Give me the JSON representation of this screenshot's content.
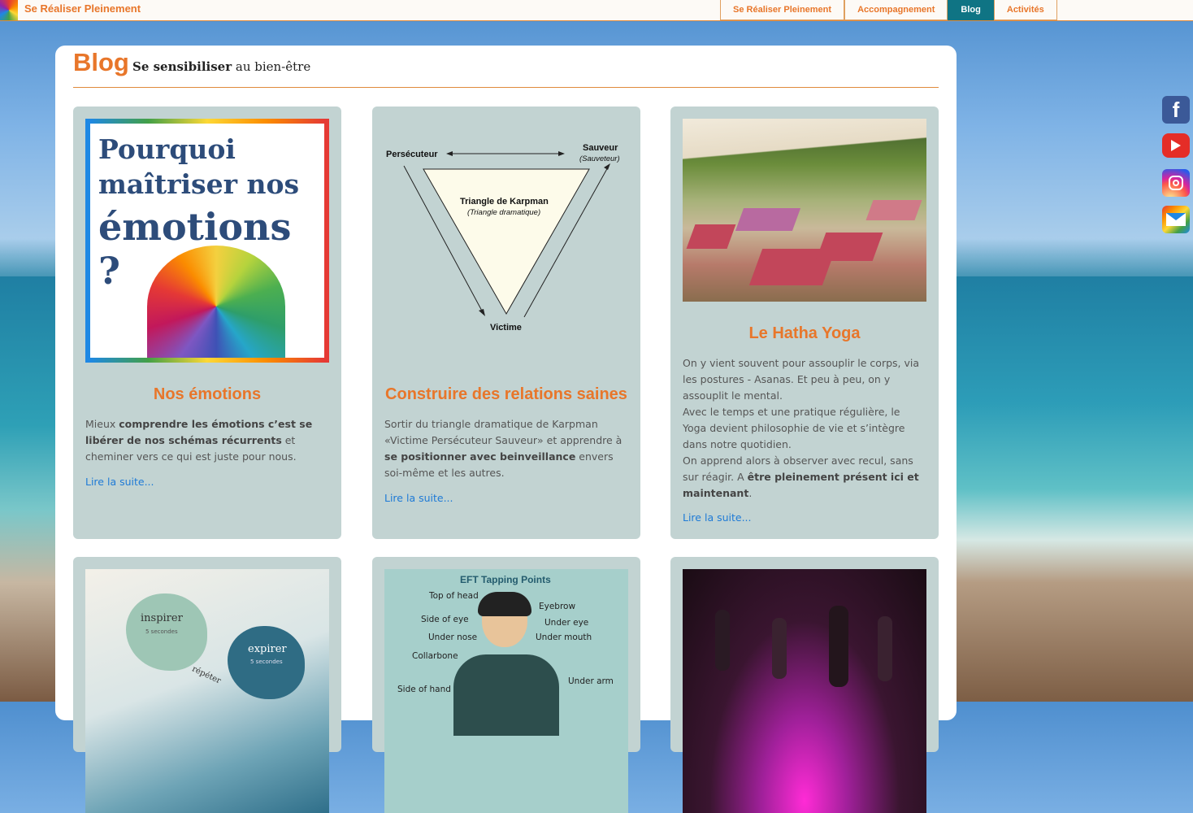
{
  "site": {
    "title": "Se Réaliser Pleinement"
  },
  "nav": {
    "items": [
      {
        "label": "Se Réaliser Pleinement"
      },
      {
        "label": "Accompagnement"
      },
      {
        "label": "Blog"
      },
      {
        "label": "Activités"
      }
    ],
    "active": "Blog"
  },
  "social": [
    "facebook-icon",
    "youtube-icon",
    "instagram-icon",
    "mail-icon"
  ],
  "header": {
    "title": "Blog",
    "subtitle_bold": "Se sensibiliser",
    "subtitle_rest": " au bien-être"
  },
  "cards": [
    {
      "image_text": {
        "line1": "Pourquoi",
        "line2": "maîtriser nos",
        "line3": "émotions ?"
      },
      "title": "Nos émotions",
      "text_1": "Mieux ",
      "bold_1": "comprendre les émotions c’est se libérer de nos schémas récurrents",
      "text_2": " et cheminer vers ce qui est juste pour nous.",
      "more": "Lire la suite..."
    },
    {
      "diagram": {
        "persecuteur": "Persécuteur",
        "sauveur": "Sauveur",
        "sauveur_sub": "(Sauveteur)",
        "center_title": "Triangle de Karpman",
        "center_sub": "(Triangle dramatique)",
        "victime": "Victime"
      },
      "title": "Construire des relations saines",
      "text_1": "Sortir du triangle dramatique de Karpman «Victime Persécuteur Sauveur» et apprendre à ",
      "bold_1": "se positionner avec beinveillance",
      "text_2": " envers soi-même et les autres.",
      "more": "Lire la suite..."
    },
    {
      "title": "Le Hatha Yoga",
      "p1": "On y vient souvent pour assouplir le corps, via les postures - Asanas. Et peu à peu, on y assouplit le mental.",
      "p2": "Avec le temps et une pratique régulière, le Yoga devient philosophie de vie et s’intègre dans notre quotidien.",
      "p3_text": "On apprend alors à observer avec recul, sans sur réagir. A ",
      "p3_bold": "être pleinement présent ici et maintenant",
      "p3_end": ".",
      "more": "Lire la suite..."
    },
    {
      "image_text": {
        "inspirer": "inspirer",
        "inspirer_sub": "5 secondes",
        "expirer": "expirer",
        "expirer_sub": "5 secondes",
        "repeter": "répéter"
      }
    },
    {
      "image_text": {
        "title": "EFT Tapping Points",
        "labels": [
          "Top of head",
          "Eyebrow",
          "Side of eye",
          "Under eye",
          "Under nose",
          "Under mouth",
          "Collarbone",
          "Under arm",
          "Side of hand"
        ]
      }
    },
    {}
  ]
}
